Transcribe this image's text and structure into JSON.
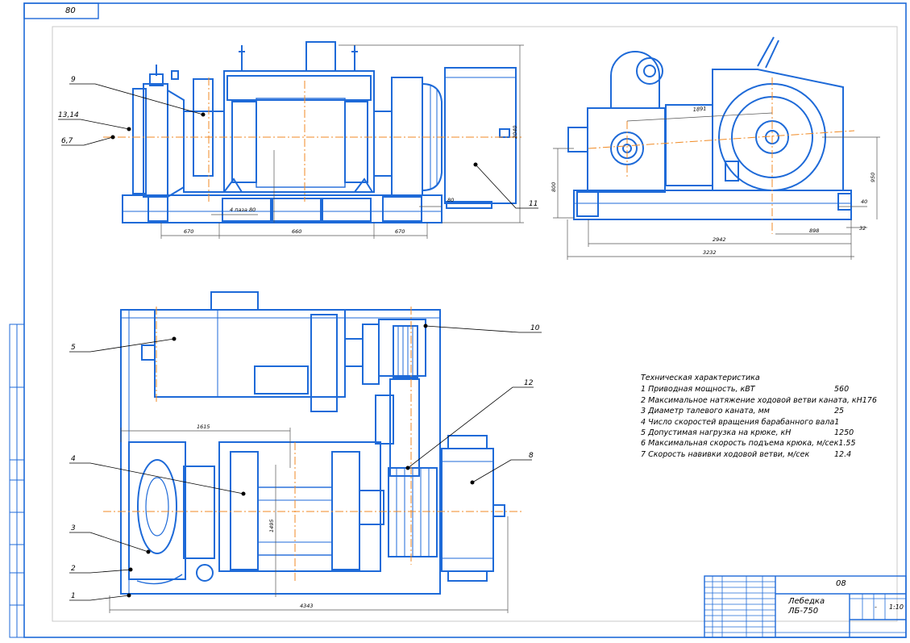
{
  "stamp": "80",
  "callouts": {
    "c9": "9",
    "c13": "13,14",
    "c67": "6,7",
    "c11": "11",
    "c5": "5",
    "c10": "10",
    "c12": "12",
    "c4": "4",
    "c8": "8",
    "c3": "3",
    "c2": "2",
    "c1": "1"
  },
  "dims": {
    "d670a": "670",
    "d660": "660",
    "d670b": "670",
    "d80": "80",
    "d2040": "2040",
    "dpaz": "4 паза 80",
    "d800": "800",
    "d1891": "1891",
    "d950": "950",
    "d40": "40",
    "d32": "32",
    "d898": "898",
    "d2942": "2942",
    "d3232": "3232",
    "d1615": "1615",
    "d1495": "1495",
    "d4343": "4343"
  },
  "spec": {
    "title": "Техническая характеристика",
    "rows": [
      {
        "label": "1 Приводная мощность, кВТ",
        "value": "560"
      },
      {
        "label": "2 Максимальное натяжение ходовой ветви каната, кН",
        "value": "176"
      },
      {
        "label": "3 Диаметр талевого каната, мм",
        "value": "25"
      },
      {
        "label": "4 Число скоростей вращения барабанного вала",
        "value": "1"
      },
      {
        "label": "5 Допустимая нагрузка на крюке, кН",
        "value": "1250"
      },
      {
        "label": "6 Максимальная скорость подъема крюка, м/сек",
        "value": "1.55"
      },
      {
        "label": "7 Скорость навивки ходовой ветви, м/сек",
        "value": "12.4"
      }
    ]
  },
  "title_block": {
    "code": "08",
    "name_line1": "Лебедка",
    "name_line2": "ЛБ-750",
    "scale": "1:10",
    "dash": "-"
  }
}
